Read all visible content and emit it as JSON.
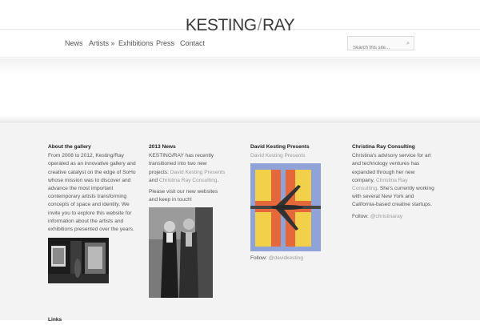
{
  "site": {
    "brand_left": "KESTING",
    "brand_sep": "/",
    "brand_right": "RAY"
  },
  "nav": {
    "items": [
      "News",
      "Artists »",
      "Exhibitions",
      "Press",
      "Contact"
    ],
    "search_placeholder": "Search this site..."
  },
  "footer": {
    "about": {
      "title": "About the gallery",
      "text": "From 2008 to 2012, Kesting/Ray operated as an innovative gallery and creative catalyst on the edge of SoHo whose mission was to discover and advance the most important contemporary artists transforming concepts of space and identity. We invite you to explore this website for information about the artists and exhibitions presented over the years."
    },
    "news": {
      "title": "2013 News",
      "intro": "KESTING/RAY has recently transitioned into two new projects: ",
      "link1": "David Kesting Presents",
      "and": " and ",
      "link2": "Christina Ray Consulting",
      "end": ".",
      "visit": "Please visit our new websites and keep in touch!"
    },
    "dkp": {
      "title": "David Kesting Presents",
      "subtitle": "David Kesting Presents",
      "follow_label": "Follow: ",
      "follow_handle": "@davidkesting"
    },
    "crc": {
      "title": "Christina Ray Consulting",
      "text1": "Christina's advisory service for art and technology ventures has expanded through her new company, ",
      "link": "Christina Ray Consulting",
      "text2": ". She's currently working with several New York and California-based creative startups.",
      "follow_label": "Follow: ",
      "follow_handle": "@christinaray"
    },
    "next_heading": "Links"
  }
}
